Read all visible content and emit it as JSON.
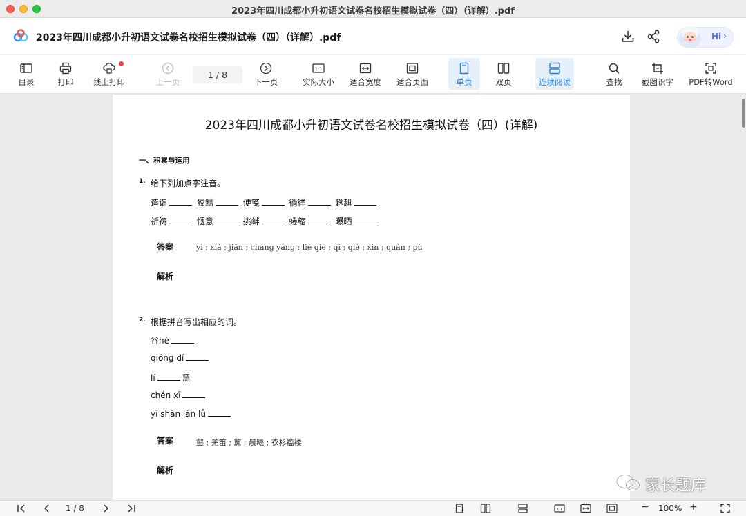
{
  "window": {
    "title": "2023年四川成都小升初语文试卷名校招生模拟试卷（四）（详解）.pdf"
  },
  "header": {
    "doc_title": "2023年四川成都小升初语文试卷名校招生模拟试卷（四）（详解）.pdf",
    "assistant_label": "Hi",
    "assistant_arrow": "›"
  },
  "toolbar": {
    "toc": "目录",
    "print": "打印",
    "online_print": "线上打印",
    "prev_page": "上一页",
    "page_indicator": "1 / 8",
    "next_page": "下一页",
    "actual_size": "实际大小",
    "fit_width": "适合宽度",
    "fit_page": "适合页面",
    "single_page": "单页",
    "double_page": "双页",
    "continuous": "连续阅读",
    "search": "查找",
    "ocr": "截图识字",
    "pdf_to_word": "PDF转Word"
  },
  "document": {
    "title": "2023年四川成都小升初语文试卷名校招生模拟试卷（四）(详解)",
    "section": "一、积累与运用",
    "q1": {
      "num": "1.",
      "text": "给下列加点字注音。",
      "row1": [
        "造诣",
        "狡黠",
        "便笺",
        "徜徉",
        "趔趄"
      ],
      "row2": [
        "祈祷",
        "惬意",
        "挑衅",
        "蜷缩",
        "曝晒"
      ],
      "answer_label": "答案",
      "answer": "yì ; xiá ; jiān ; cháng yáng ; liè qie ; qí ; qiè ; xìn ; quán ; pù",
      "analysis_label": "解析"
    },
    "q2": {
      "num": "2.",
      "text": "根据拼音写出相应的词。",
      "lines": [
        {
          "before": "谷hè",
          "after": ""
        },
        {
          "before": "qiǒng dí",
          "after": ""
        },
        {
          "before": "lí",
          "after": "黑"
        },
        {
          "before": "chén xī",
          "after": ""
        },
        {
          "before": "yī shān lán lǚ",
          "after": ""
        }
      ],
      "answer_label": "答案",
      "answer": "壑 ; 羌笛 ; 黧 ; 晨曦 ; 衣衫褴褛",
      "analysis_label": "解析"
    }
  },
  "watermark": "家长题库",
  "bottombar": {
    "page_indicator": "1 / 8",
    "zoom": "100%",
    "zoom_minus": "−",
    "zoom_plus": "+"
  }
}
